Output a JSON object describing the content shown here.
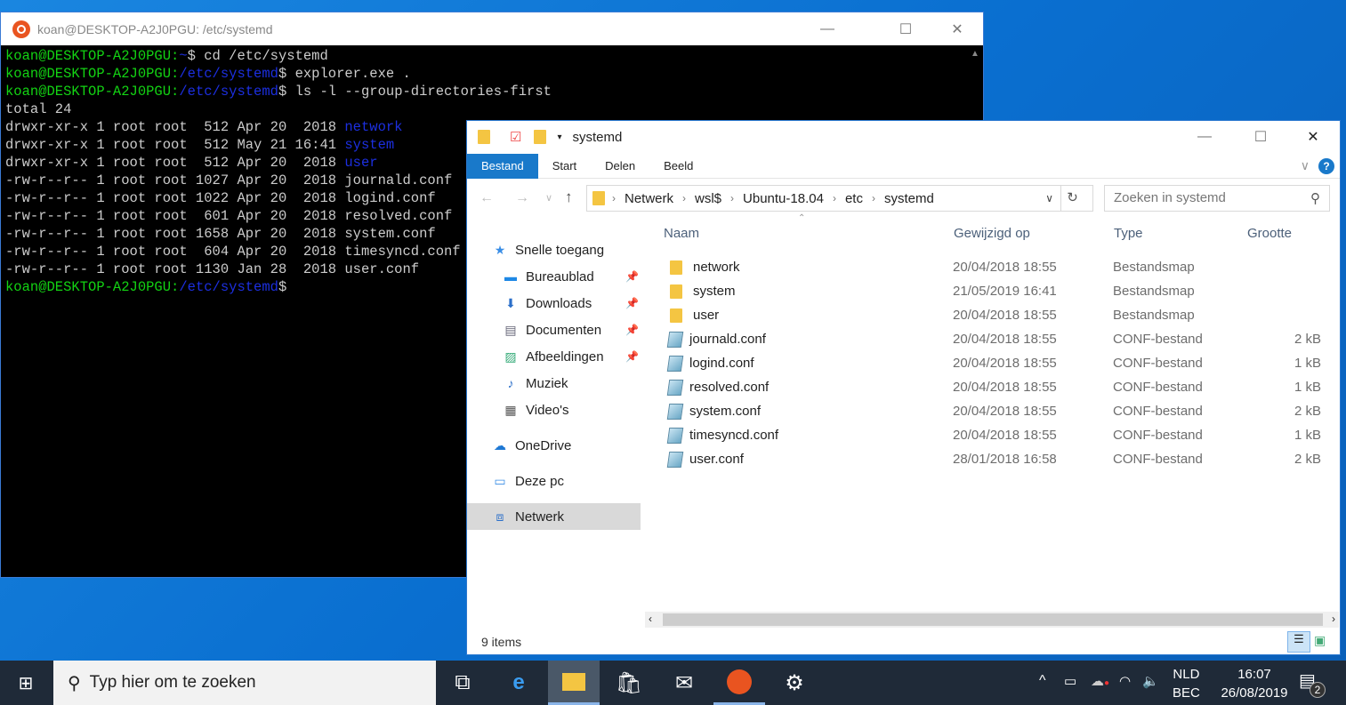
{
  "terminal": {
    "title": "koan@DESKTOP-A2J0PGU: /etc/systemd",
    "prompt_user": "koan@DESKTOP-A2J0PGU:",
    "lines": [
      {
        "path": "~",
        "cmd": "$ cd /etc/systemd"
      },
      {
        "path": "/etc/systemd",
        "cmd": "$ explorer.exe ."
      },
      {
        "path": "/etc/systemd",
        "cmd": "$ ls -l --group-directories-first"
      }
    ],
    "total": "total 24",
    "listing": [
      {
        "meta": "drwxr-xr-x 1 root root  512 Apr 20  2018 ",
        "name": "network",
        "dir": true
      },
      {
        "meta": "drwxr-xr-x 1 root root  512 May 21 16:41 ",
        "name": "system",
        "dir": true
      },
      {
        "meta": "drwxr-xr-x 1 root root  512 Apr 20  2018 ",
        "name": "user",
        "dir": true
      },
      {
        "meta": "-rw-r--r-- 1 root root 1027 Apr 20  2018 ",
        "name": "journald.conf",
        "dir": false
      },
      {
        "meta": "-rw-r--r-- 1 root root 1022 Apr 20  2018 ",
        "name": "logind.conf",
        "dir": false
      },
      {
        "meta": "-rw-r--r-- 1 root root  601 Apr 20  2018 ",
        "name": "resolved.conf",
        "dir": false
      },
      {
        "meta": "-rw-r--r-- 1 root root 1658 Apr 20  2018 ",
        "name": "system.conf",
        "dir": false
      },
      {
        "meta": "-rw-r--r-- 1 root root  604 Apr 20  2018 ",
        "name": "timesyncd.conf",
        "dir": false
      },
      {
        "meta": "-rw-r--r-- 1 root root 1130 Jan 28  2018 ",
        "name": "user.conf",
        "dir": false
      }
    ],
    "final_path": "/etc/systemd",
    "final_cmd": "$"
  },
  "explorer": {
    "title": "systemd",
    "tabs": [
      "Bestand",
      "Start",
      "Delen",
      "Beeld"
    ],
    "breadcrumb": [
      "Netwerk",
      "wsl$",
      "Ubuntu-18.04",
      "etc",
      "systemd"
    ],
    "search_placeholder": "Zoeken in systemd",
    "nav": [
      {
        "label": "Snelle toegang",
        "icon": "star-icon",
        "pinned": false
      },
      {
        "label": "Bureaublad",
        "icon": "desktop-icon",
        "pinned": true
      },
      {
        "label": "Downloads",
        "icon": "download-icon",
        "pinned": true
      },
      {
        "label": "Documenten",
        "icon": "document-icon",
        "pinned": true
      },
      {
        "label": "Afbeeldingen",
        "icon": "image-icon",
        "pinned": true
      },
      {
        "label": "Muziek",
        "icon": "music-icon",
        "pinned": false
      },
      {
        "label": "Video's",
        "icon": "video-icon",
        "pinned": false
      },
      {
        "label": "OneDrive",
        "icon": "cloud-icon",
        "pinned": false
      },
      {
        "label": "Deze pc",
        "icon": "computer-icon",
        "pinned": false
      },
      {
        "label": "Netwerk",
        "icon": "network-icon",
        "pinned": false,
        "selected": true
      }
    ],
    "columns": [
      "Naam",
      "Gewijzigd op",
      "Type",
      "Grootte"
    ],
    "files": [
      {
        "name": "network",
        "date": "20/04/2018 18:55",
        "type": "Bestandsmap",
        "size": ""
      },
      {
        "name": "system",
        "date": "21/05/2019 16:41",
        "type": "Bestandsmap",
        "size": ""
      },
      {
        "name": "user",
        "date": "20/04/2018 18:55",
        "type": "Bestandsmap",
        "size": ""
      },
      {
        "name": "journald.conf",
        "date": "20/04/2018 18:55",
        "type": "CONF-bestand",
        "size": "2 kB"
      },
      {
        "name": "logind.conf",
        "date": "20/04/2018 18:55",
        "type": "CONF-bestand",
        "size": "1 kB"
      },
      {
        "name": "resolved.conf",
        "date": "20/04/2018 18:55",
        "type": "CONF-bestand",
        "size": "1 kB"
      },
      {
        "name": "system.conf",
        "date": "20/04/2018 18:55",
        "type": "CONF-bestand",
        "size": "2 kB"
      },
      {
        "name": "timesyncd.conf",
        "date": "20/04/2018 18:55",
        "type": "CONF-bestand",
        "size": "1 kB"
      },
      {
        "name": "user.conf",
        "date": "28/01/2018 16:58",
        "type": "CONF-bestand",
        "size": "2 kB"
      }
    ],
    "status": "9 items"
  },
  "taskbar": {
    "search_placeholder": "Typ hier om te zoeken",
    "lang1": "NLD",
    "lang2": "BEC",
    "time": "16:07",
    "date": "26/08/2019",
    "notifications": "2"
  },
  "colors": {
    "accent": "#1979ca",
    "prompt_green": "#13d313",
    "dir_blue": "#1c2fe0",
    "taskbar": "#1f2a38"
  }
}
